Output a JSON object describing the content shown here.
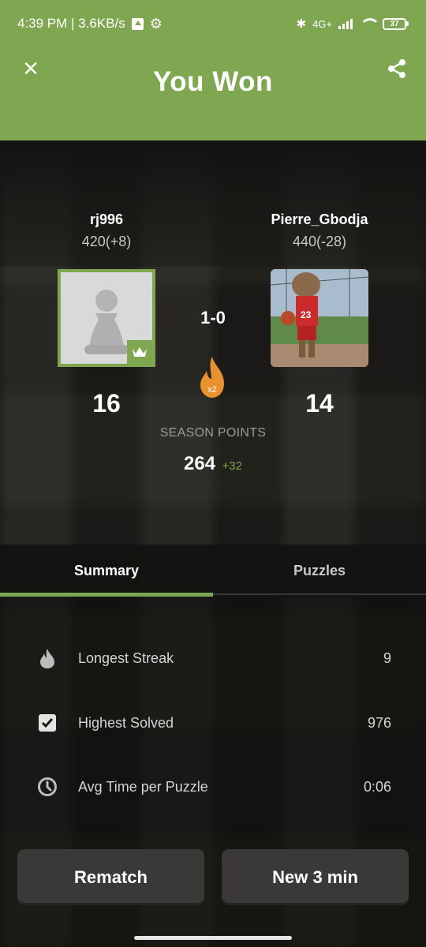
{
  "status_bar": {
    "time_speed": "4:39 PM | 3.6KB/s",
    "network": "4G+",
    "battery": "37"
  },
  "header": {
    "title": "You Won",
    "background_color": "#7fa650"
  },
  "player_left": {
    "name": "rj996",
    "rating": "420(+8)",
    "points": "16",
    "avatar": "pawn-avatar",
    "winner": true
  },
  "player_right": {
    "name": "Pierre_Gbodja",
    "rating": "440(-28)",
    "points": "14",
    "avatar": "photo-avatar"
  },
  "match": {
    "score": "1-0",
    "multiplier": "x2"
  },
  "season": {
    "label": "SEASON POINTS",
    "value": "264",
    "delta": "+32"
  },
  "tabs": [
    {
      "label": "Summary",
      "active": true
    },
    {
      "label": "Puzzles",
      "active": false
    }
  ],
  "stats": [
    {
      "icon": "flame-icon",
      "label": "Longest Streak",
      "value": "9"
    },
    {
      "icon": "checkbox-icon",
      "label": "Highest Solved",
      "value": "976"
    },
    {
      "icon": "clock-icon",
      "label": "Avg Time per Puzzle",
      "value": "0:06"
    }
  ],
  "buttons": {
    "rematch": "Rematch",
    "new_game": "New 3 min"
  },
  "colors": {
    "accent": "#7fa650",
    "flame": "#e8912f",
    "button_bg": "#3a3937"
  }
}
